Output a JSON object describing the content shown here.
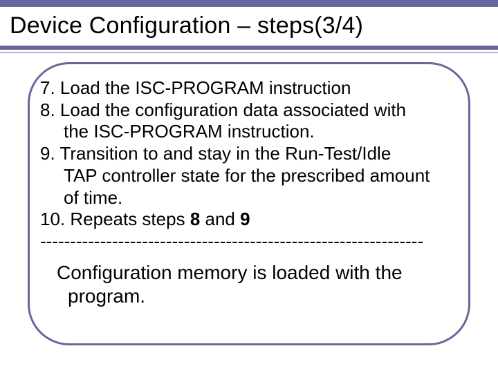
{
  "title": "Device Configuration – steps(3/4)",
  "body": {
    "l1": "7. Load the ISC-PROGRAM instruction",
    "l2": "8. Load the configuration data associated with",
    "l3": "the ISC-PROGRAM instruction.",
    "l4": "9. Transition to and stay in the Run-Test/Idle",
    "l5": "TAP controller state for the prescribed amount",
    "l6": "of time.",
    "l7a": "10. Repeats steps ",
    "l7b": "8",
    "l7c": " and ",
    "l7d": "9",
    "sep": "----------------------------------------------------------------"
  },
  "conclusion": {
    "c1": "Configuration memory is loaded with the",
    "c2": "program."
  }
}
